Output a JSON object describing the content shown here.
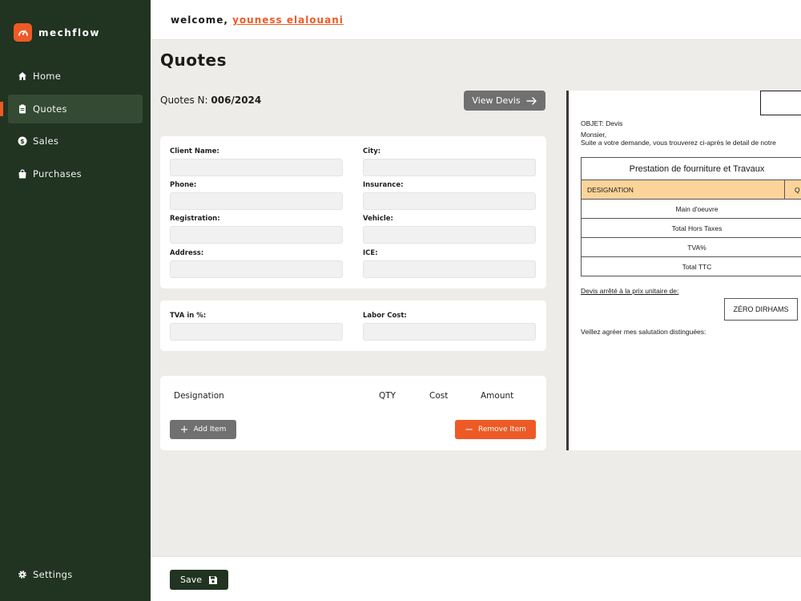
{
  "brand": {
    "name": "mechflow"
  },
  "nav": {
    "items": [
      {
        "label": "Home",
        "icon": "home-icon"
      },
      {
        "label": "Quotes",
        "icon": "clipboard-icon",
        "active": true
      },
      {
        "label": "Sales",
        "icon": "dollar-icon"
      },
      {
        "label": "Purchases",
        "icon": "shopping-bag-icon"
      }
    ],
    "settings": {
      "label": "Settings",
      "icon": "gear-icon"
    }
  },
  "header": {
    "welcome_prefix": "welcome,",
    "user_name": "youness elalouani"
  },
  "page": {
    "title": "Quotes",
    "quote_number_label": "Quotes N:",
    "quote_number": "006/2024",
    "view_button": "View Devis"
  },
  "client_form": {
    "client_name_label": "Client Name:",
    "city_label": "City:",
    "phone_label": "Phone:",
    "insurance_label": "Insurance:",
    "registration_label": "Registration:",
    "vehicle_label": "Vehicle:",
    "address_label": "Address:",
    "ice_label": "ICE:"
  },
  "cost_form": {
    "tva_label": "TVA in %:",
    "labor_label": "Labor Cost:"
  },
  "items": {
    "headers": [
      "Designation",
      "QTY",
      "Cost",
      "Amount"
    ],
    "add_button": "Add Item",
    "remove_button": "Remove Item"
  },
  "preview": {
    "objet": "OBJET:  Devis",
    "greeting": "Monsier,",
    "intro": "Suite a votre demande, vous trouverez ci-après le detail de notre",
    "table_title": "Prestation de fourniture et Travaux",
    "col_designation": "DESIGNATION",
    "col_qty": "Q",
    "rows": [
      "Main d'oeuvre",
      "Total Hors Taxes",
      "TVA%",
      "Total TTC"
    ],
    "stopped_at": "Devis arrêté à la prix unitaire de:",
    "amount_words": "ZÉRO DIRHAMS",
    "closing": "Veillez agréer mes salutation distinguées:"
  },
  "footer": {
    "save_button": "Save"
  },
  "colors": {
    "sidebar": "#213321",
    "accent": "#ee5a25",
    "active_nav": "#344a33",
    "table_header": "#fcd49a"
  }
}
